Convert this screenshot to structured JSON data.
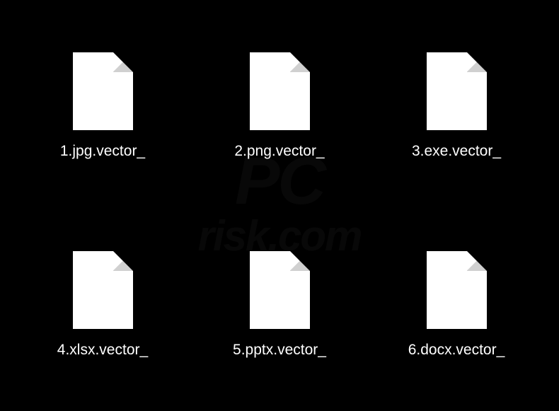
{
  "files": [
    {
      "name": "1.jpg.vector_"
    },
    {
      "name": "2.png.vector_"
    },
    {
      "name": "3.exe.vector_"
    },
    {
      "name": "4.xlsx.vector_"
    },
    {
      "name": "5.pptx.vector_"
    },
    {
      "name": "6.docx.vector_"
    }
  ],
  "watermark": {
    "line1": "PC",
    "line2": "risk.com"
  }
}
